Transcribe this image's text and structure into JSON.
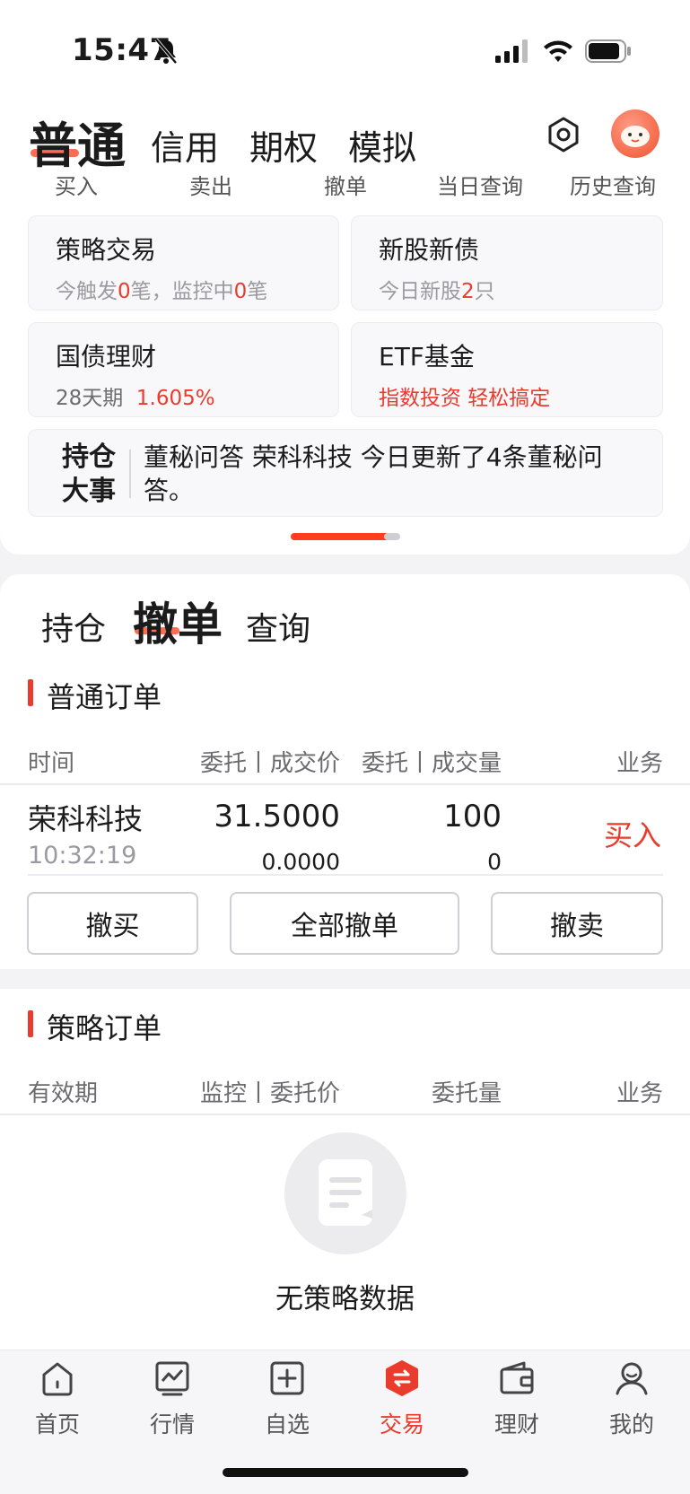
{
  "status_bar": {
    "time": "15:47"
  },
  "header": {
    "tabs": [
      "普通",
      "信用",
      "期权",
      "模拟"
    ],
    "active_tab": "普通"
  },
  "actions": [
    "买入",
    "卖出",
    "撤单",
    "当日查询",
    "历史查询"
  ],
  "tiles": {
    "strategy": {
      "title": "策略交易",
      "sub_prefix": "今触发",
      "count1": "0",
      "sub_mid": "笔，监控中",
      "count2": "0",
      "sub_suffix": "笔"
    },
    "ipo": {
      "title": "新股新债",
      "sub_prefix": "今日新股",
      "count": "2",
      "sub_suffix": "只"
    },
    "bond": {
      "title": "国债理财",
      "term": "28天期",
      "rate": "1.605%"
    },
    "etf": {
      "title": "ETF基金",
      "sub": "指数投资 轻松搞定"
    }
  },
  "news": {
    "tag_line1": "持仓",
    "tag_line2": "大事",
    "text": "董秘问答 荣科科技 今日更新了4条董秘问答。"
  },
  "order_tabs": [
    "持仓",
    "撤单",
    "查询"
  ],
  "normal_orders": {
    "title": "普通订单",
    "columns": [
      "时间",
      "委托丨成交价",
      "委托丨成交量",
      "业务"
    ],
    "rows": [
      {
        "name": "荣科科技",
        "time": "10:32:19",
        "order_price": "31.5000",
        "deal_price": "0.0000",
        "order_qty": "100",
        "deal_qty": "0",
        "biz": "买入"
      }
    ],
    "buttons": [
      "撤买",
      "全部撤单",
      "撤卖"
    ]
  },
  "strategy_orders": {
    "title": "策略订单",
    "columns": [
      "有效期",
      "监控丨委托价",
      "委托量",
      "业务"
    ],
    "empty_text": "无策略数据"
  },
  "bottom_nav": [
    {
      "label": "首页",
      "icon": "home-icon"
    },
    {
      "label": "行情",
      "icon": "chart-icon"
    },
    {
      "label": "自选",
      "icon": "add-box-icon"
    },
    {
      "label": "交易",
      "icon": "trade-icon"
    },
    {
      "label": "理财",
      "icon": "wallet-icon"
    },
    {
      "label": "我的",
      "icon": "profile-icon"
    }
  ],
  "colors": {
    "accent": "#ea3b2c",
    "tab_underline": "#ff5233"
  }
}
